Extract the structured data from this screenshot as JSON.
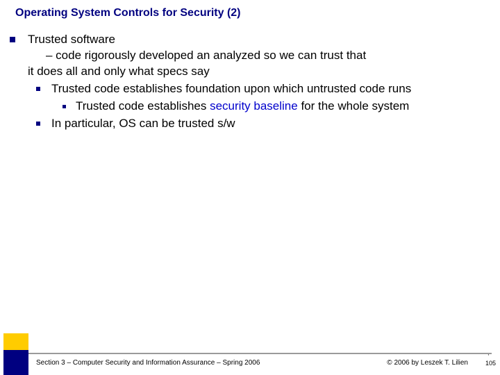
{
  "title": "Operating System Controls for Security (2)",
  "body": {
    "l0_text": "Trusted software",
    "dash1": "– code rigorously developed an analyzed so we can trust that",
    "dash2": "it does all and only what specs say",
    "l1a_text": "Trusted code establishes foundation upon which untrusted code runs",
    "l2_pre": "Trusted code establishes ",
    "l2_link": "security baseline",
    "l2_post": " for the whole system",
    "l1b_text": "In particular, OS can be trusted s/w"
  },
  "footer": {
    "left": "Section 3 – Computer Security and Information Assurance – Spring 2006",
    "right": "© 2006 by Leszek T. Lilien",
    "page": "105",
    "mark": "'"
  }
}
